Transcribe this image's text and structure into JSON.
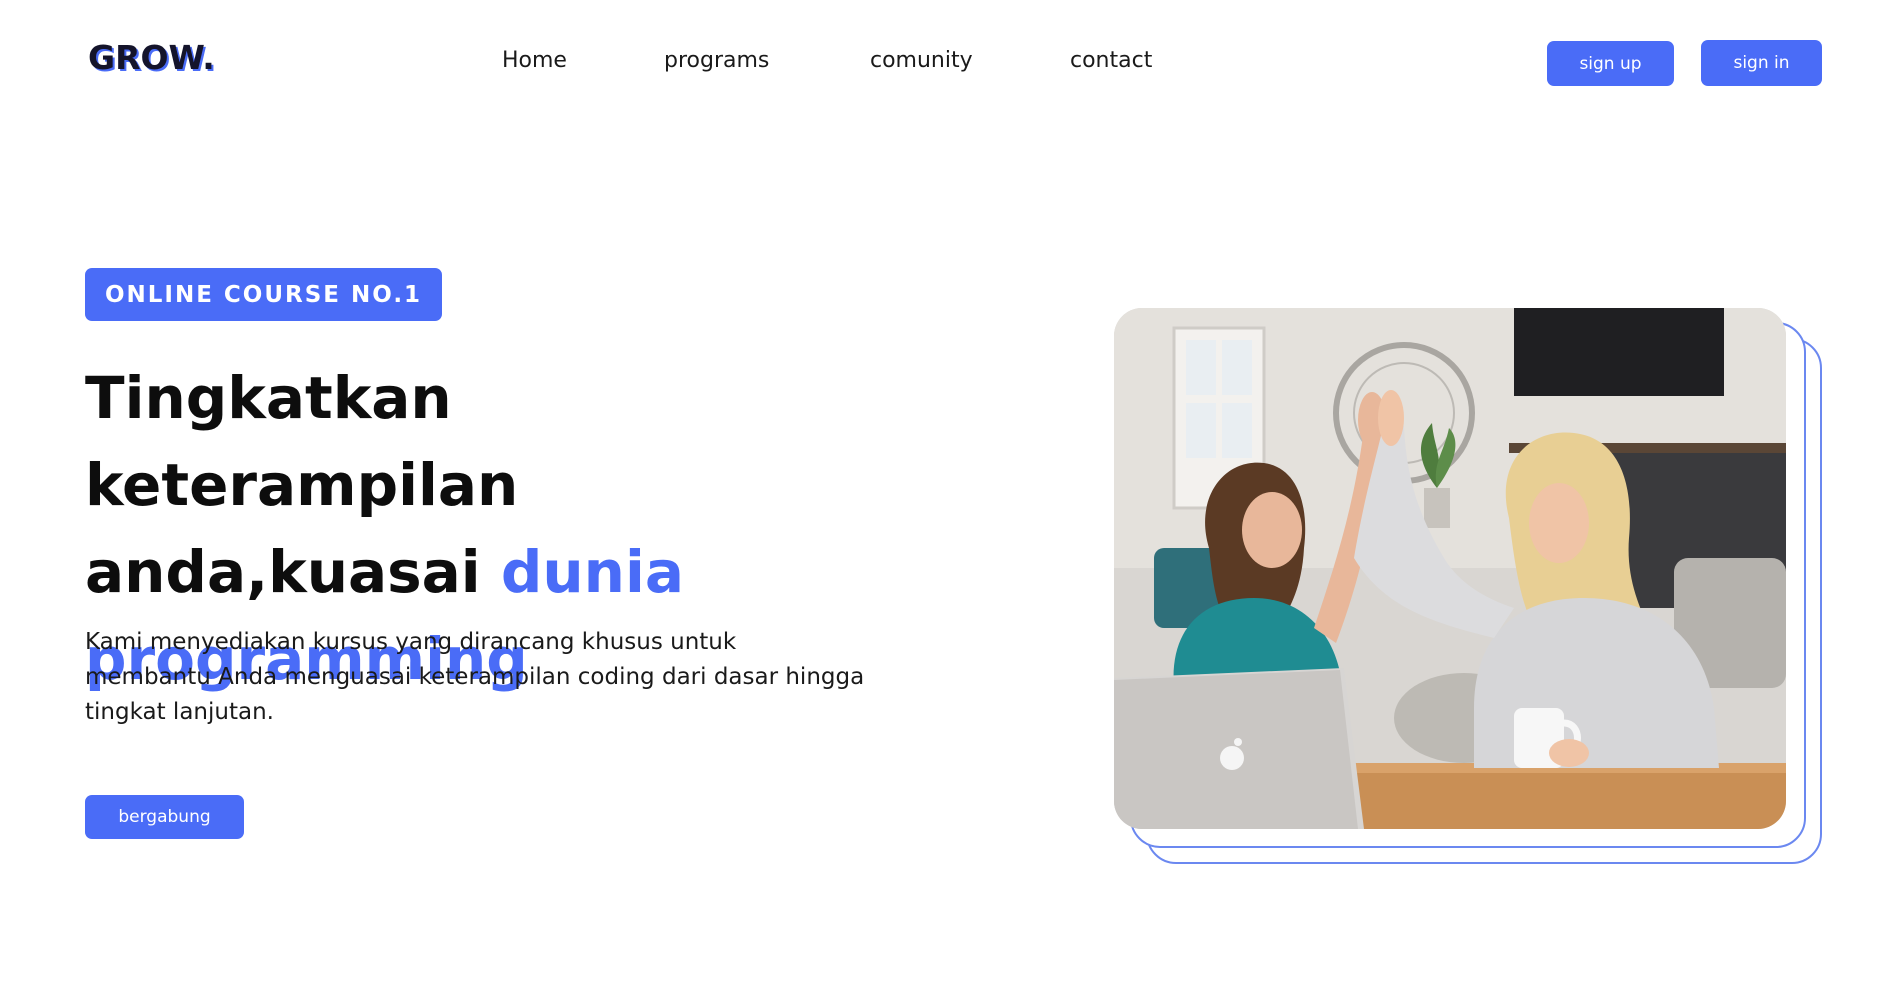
{
  "brand": {
    "logo": "GROW."
  },
  "nav": {
    "links": [
      "Home",
      "programs",
      "comunity",
      "contact"
    ]
  },
  "auth": {
    "signup_label": "sign up",
    "signin_label": "sign in"
  },
  "hero": {
    "badge": "ONLINE COURSE NO.1",
    "headline_part1": "Tingkatkan keterampilan anda,kuasai ",
    "headline_accent": "dunia programming",
    "description": "Kami menyediakan kursus yang dirancang khusus untuk membantu Anda menguasai keterampilan coding dari dasar hingga tingkat lanjutan.",
    "cta_label": "bergabung"
  },
  "colors": {
    "accent": "#4a6cf7",
    "text": "#111111",
    "background": "#ffffff"
  },
  "image": {
    "subject": "two-women-high-five-photo"
  }
}
